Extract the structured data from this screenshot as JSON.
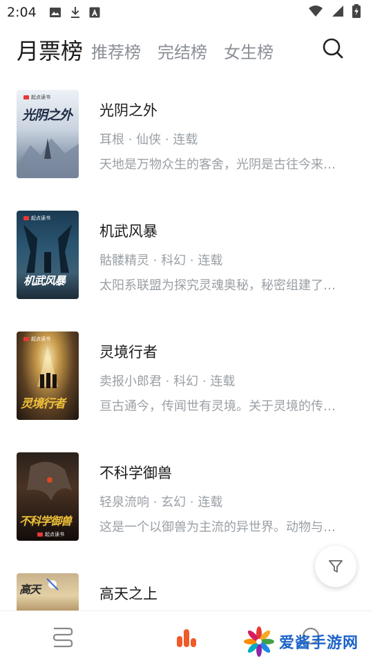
{
  "status_bar": {
    "time": "2:04",
    "icons": [
      "image-icon",
      "download-icon",
      "font-icon",
      "wifi-icon",
      "signal-icon",
      "battery-icon"
    ]
  },
  "header": {
    "tabs": [
      {
        "label": "月票榜",
        "active": true
      },
      {
        "label": "推荐榜",
        "active": false
      },
      {
        "label": "完结榜",
        "active": false
      },
      {
        "label": "女生榜",
        "active": false
      }
    ],
    "search_icon": "search-icon"
  },
  "books": [
    {
      "title": "光阴之外",
      "meta": "耳根 · 仙侠 · 连载",
      "desc": "天地是万物众生的客舍，光阴是古往今来的过客",
      "cover_text": "光阴之外"
    },
    {
      "title": "机武风暴",
      "meta": "骷髅精灵 · 科幻 · 连载",
      "desc": "太阳系联盟为探究灵魂奥秘，秘密组建了灵能研究所",
      "cover_text": "机武风暴"
    },
    {
      "title": "灵境行者",
      "meta": "卖报小郎君 · 科幻 · 连载",
      "desc": "亘古通今，传闻世有灵境。关于灵境的传说流传已久",
      "cover_text": "灵境行者"
    },
    {
      "title": "不科学御兽",
      "meta": "轻泉流响 · 玄幻 · 连载",
      "desc": "这是一个以御兽为主流的异世界。动物与人类共存",
      "cover_text": "不科学御兽"
    },
    {
      "title": "高天之上",
      "meta": "",
      "desc": "",
      "cover_text": "高天"
    }
  ],
  "cover_brand": "起点读书",
  "filter_icon": "filter-icon",
  "bottom_nav": {
    "items": [
      "bookshelf-icon",
      "ranking-icon",
      "profile-icon"
    ],
    "active": 1
  },
  "watermark": {
    "text": "爱酱手游网"
  },
  "colors": {
    "accent": "#f05a28",
    "muted": "#9aa0a6",
    "title": "#1a1a1a",
    "watermark": "#1c63c8"
  }
}
